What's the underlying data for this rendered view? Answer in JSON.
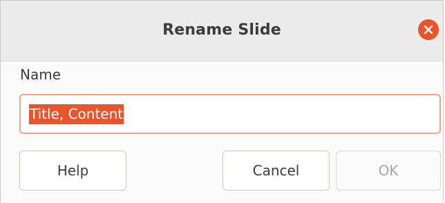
{
  "dialog": {
    "title": "Rename Slide",
    "close_icon": "close-icon",
    "accent_color": "#e9542a"
  },
  "form": {
    "name_label": "Name",
    "name_value": "Title, Content"
  },
  "buttons": {
    "help_label": "Help",
    "cancel_label": "Cancel",
    "ok_label": "OK",
    "ok_enabled": false
  }
}
